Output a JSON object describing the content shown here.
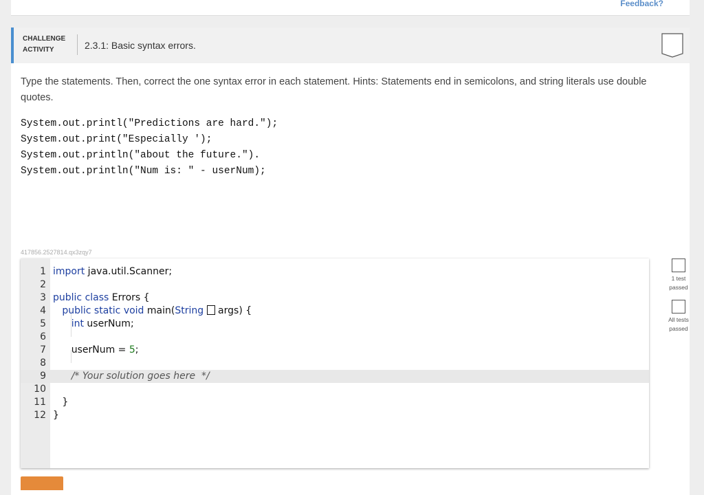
{
  "feedback_link": "Feedback?",
  "header": {
    "label_line1": "CHALLENGE",
    "label_line2": "ACTIVITY",
    "title": "2.3.1: Basic syntax errors."
  },
  "instructions": "Type the statements. Then, correct the one syntax error in each statement. Hints: Statements end in semicolons, and string literals use double quotes.",
  "code_sample": [
    "System.out.printl(\"Predictions are hard.\");",
    "System.out.print(\"Especially ');",
    "System.out.println(\"about the future.\").",
    "System.out.println(\"Num is: \" - userNum);"
  ],
  "challenge_id": "417856.2527814.qx3zqy7",
  "editor": {
    "line_numbers": [
      "1",
      "2",
      "3",
      "4",
      "5",
      "6",
      "7",
      "8",
      "9",
      "10",
      "11",
      "12"
    ],
    "lines": {
      "l1_kw": "import",
      "l1_rest": " java.util.Scanner;",
      "l3_kw1": "public",
      "l3_kw2": "class",
      "l3_rest": " Errors {",
      "l4_kw": "public static void",
      "l4_mid": " main(",
      "l4_type": "String",
      "l4_end": " args) {",
      "l5_kw": "int",
      "l5_rest": " userNum;",
      "l7_a": "userNum = ",
      "l7_num": "5",
      "l7_b": ";",
      "l9_comment": "/* Your solution goes here  */",
      "l11": "}",
      "l12": "}"
    }
  },
  "tests": [
    {
      "label": "1 test passed"
    },
    {
      "label": "All tests passed"
    }
  ],
  "colors": {
    "accent": "#4a8fd0",
    "button": "#e58a3a",
    "keyword": "#1d3fa0",
    "number": "#1c7a1c"
  }
}
